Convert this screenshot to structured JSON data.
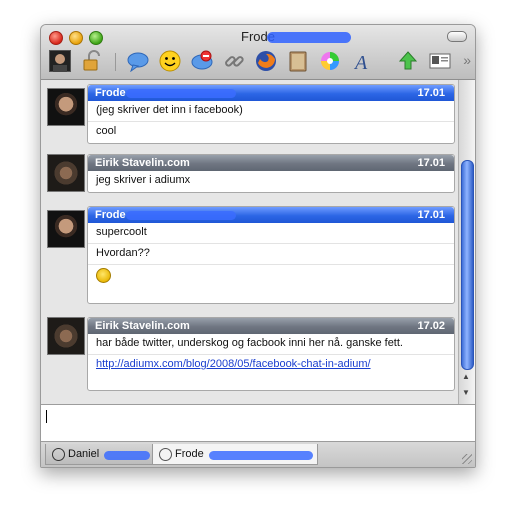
{
  "window": {
    "title": "Frode"
  },
  "toolbar": {
    "icons": [
      "user-avatar-icon",
      "lock-icon",
      "speech-bubble-icon",
      "smiley-icon",
      "block-icon",
      "link-icon",
      "firefox-icon",
      "address-book-icon",
      "color-wheel-icon",
      "font-icon",
      "upload-icon",
      "info-card-icon",
      "more-chevron-icon"
    ]
  },
  "messages": [
    {
      "sender": "Frode",
      "time": "17.01",
      "style": "own",
      "lines": [
        "(jeg skriver det inn i facebook)",
        "cool"
      ]
    },
    {
      "sender": "Eirik Stavelin.com",
      "time": "17.01",
      "style": "other",
      "lines": [
        "jeg skriver i adiumx"
      ]
    },
    {
      "sender": "Frode",
      "time": "17.01",
      "style": "own",
      "lines": [
        "supercoolt",
        "Hvordan??",
        "smiley-emoticon"
      ]
    },
    {
      "sender": "Eirik Stavelin.com",
      "time": "17.02",
      "style": "other",
      "lines": [
        "har både twitter, underskog og facbook inni her nå. ganske fett.",
        "http://adiumx.com/blog/2008/05/facebook-chat-in-adium/"
      ]
    }
  ],
  "input": {
    "value": ""
  },
  "tabs": [
    {
      "label": "Daniel"
    },
    {
      "label": "Frode"
    }
  ],
  "colors": {
    "own_header": "#2c66e5",
    "other_header": "#6f7682",
    "link": "#1a3ecf",
    "scroll_thumb": "#3f6fd8"
  }
}
